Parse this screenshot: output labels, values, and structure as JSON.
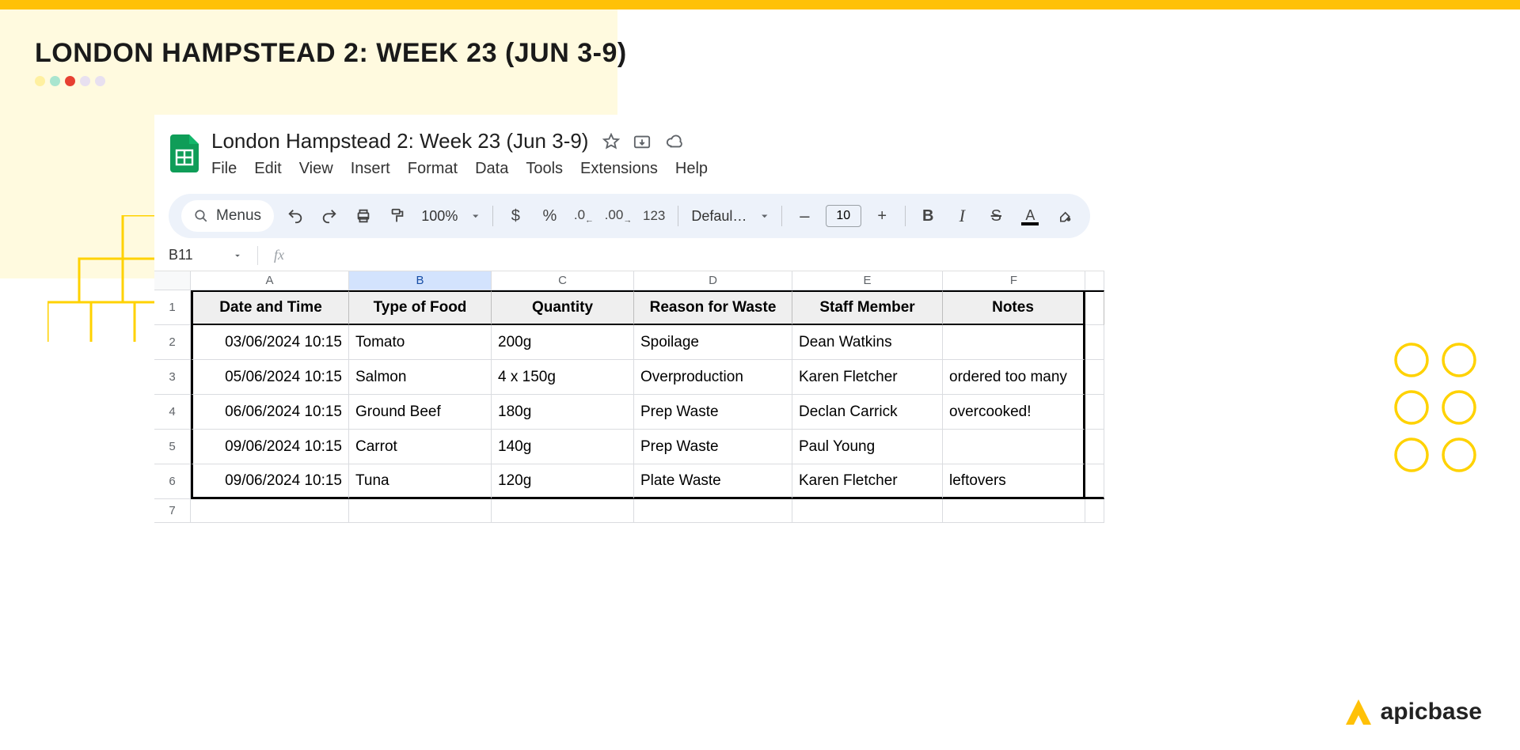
{
  "page_title": "LONDON HAMPSTEAD 2: WEEK 23 (JUN 3-9)",
  "logo_text": "apicbase",
  "sheets": {
    "doc_title": "London Hampstead 2: Week 23 (Jun 3-9)",
    "menus": [
      "File",
      "Edit",
      "View",
      "Insert",
      "Format",
      "Data",
      "Tools",
      "Extensions",
      "Help"
    ],
    "toolbar": {
      "menus_label": "Menus",
      "zoom": "100%",
      "currency": "$",
      "percent": "%",
      "dec_dec": ".0",
      "inc_dec": ".00",
      "numfmt": "123",
      "font": "Defaul…",
      "decrease": "–",
      "font_size": "10",
      "increase": "+"
    },
    "name_box": "B11",
    "fx_label": "fx",
    "columns": [
      "A",
      "B",
      "C",
      "D",
      "E",
      "F"
    ],
    "selected_col": "B",
    "row_numbers": [
      1,
      2,
      3,
      4,
      5,
      6,
      7
    ],
    "headers": [
      "Date and Time",
      "Type of Food",
      "Quantity",
      "Reason for Waste",
      "Staff Member",
      "Notes"
    ],
    "rows": [
      {
        "date": "03/06/2024 10:15",
        "food": "Tomato",
        "qty": "200g",
        "reason": "Spoilage",
        "staff": "Dean Watkins",
        "notes": ""
      },
      {
        "date": "05/06/2024 10:15",
        "food": "Salmon",
        "qty": "4 x 150g",
        "reason": "Overproduction",
        "staff": "Karen Fletcher",
        "notes": "ordered too many"
      },
      {
        "date": "06/06/2024 10:15",
        "food": "Ground Beef",
        "qty": "180g",
        "reason": "Prep Waste",
        "staff": "Declan Carrick",
        "notes": "overcooked!"
      },
      {
        "date": "09/06/2024 10:15",
        "food": "Carrot",
        "qty": "140g",
        "reason": "Prep Waste",
        "staff": "Paul Young",
        "notes": ""
      },
      {
        "date": "09/06/2024 10:15",
        "food": "Tuna",
        "qty": "120g",
        "reason": "Plate Waste",
        "staff": "Karen Fletcher",
        "notes": "leftovers"
      }
    ]
  }
}
